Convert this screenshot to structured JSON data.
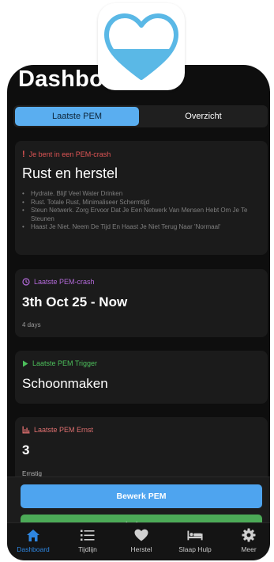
{
  "header": {
    "title": "Dashboard"
  },
  "segments": {
    "active": "Laatste PEM",
    "inactive": "Overzicht"
  },
  "cards": {
    "crash_status": {
      "label": "Je bent in een PEM-crash",
      "title": "Rust en herstel",
      "tips": [
        "Hydrate. Blijf Veel Water Drinken",
        "Rust. Totale Rust, Minimaliseer Schermtijd",
        "Steun Netwerk. Zorg Ervoor Dat Je Een Netwerk Van Mensen Hebt Om Je Te Steunen",
        "Haast Je Niet. Neem De Tijd En Haast Je Niet Terug Naar 'Normaal'"
      ]
    },
    "last_crash": {
      "label": "Laatste PEM-crash",
      "value": "3th Oct 25 - Now",
      "sub": "4 days"
    },
    "trigger": {
      "label": "Laatste PEM Trigger",
      "value": "Schoonmaken"
    },
    "severity": {
      "label": "Laatste PEM Ernst",
      "value": "3",
      "sub": "Ernstig"
    }
  },
  "actions": {
    "edit": "Bewerk PEM",
    "end": "Einde PEM"
  },
  "tabs": [
    {
      "label": "Dashboard",
      "icon": "home-icon"
    },
    {
      "label": "Tijdlijn",
      "icon": "list-icon"
    },
    {
      "label": "Herstel",
      "icon": "heart-icon"
    },
    {
      "label": "Slaap Hulp",
      "icon": "bed-icon"
    },
    {
      "label": "Meer",
      "icon": "gear-icon"
    }
  ],
  "colors": {
    "accent": "#5aaef0",
    "crash_red": "#e05555",
    "crash_purple": "#b36ad9",
    "trigger_green": "#4cbf5b",
    "severity_red": "#e07070",
    "end_green": "#4caa57"
  }
}
